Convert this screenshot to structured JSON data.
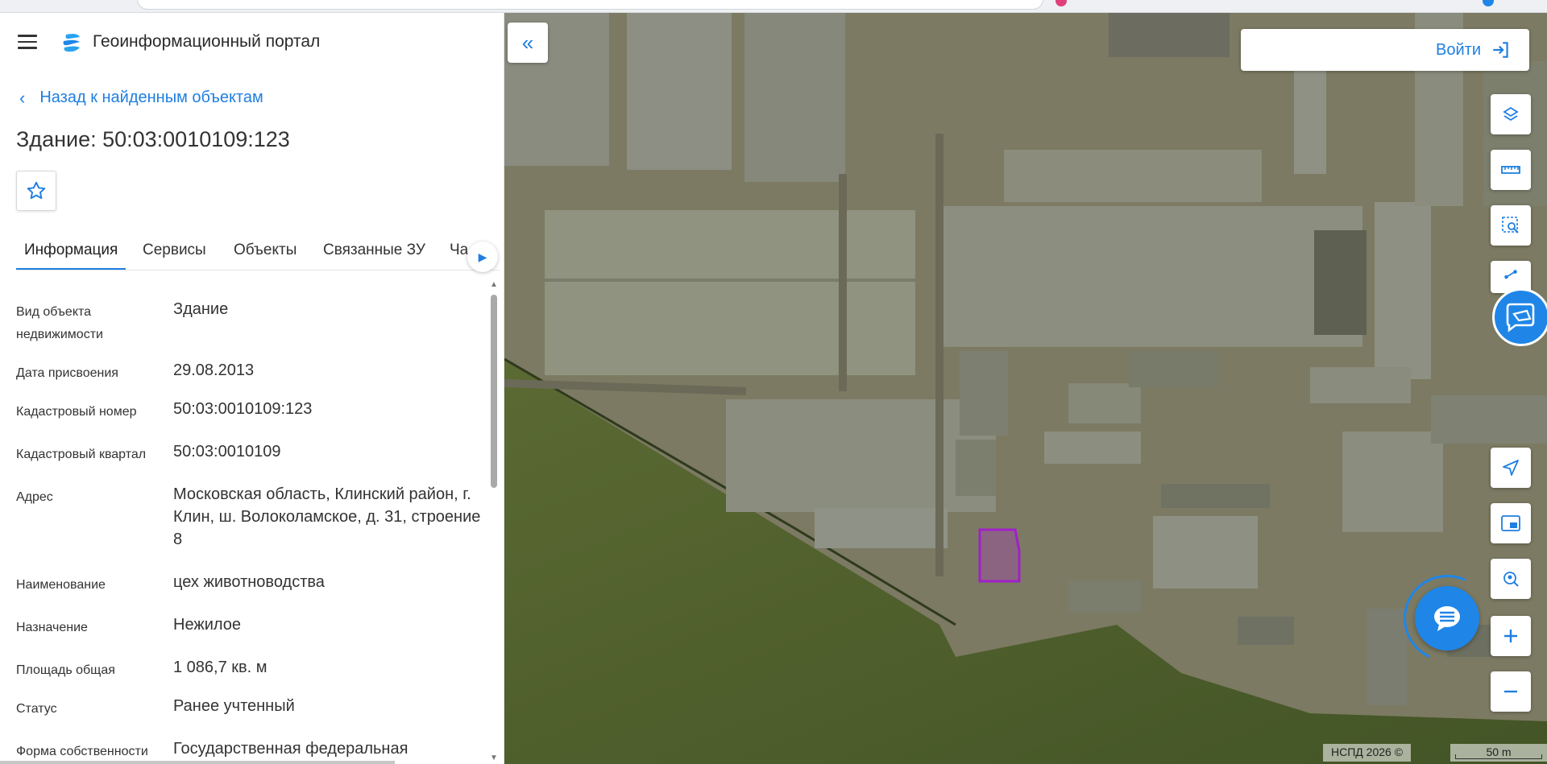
{
  "header": {
    "portal_title": "Геоинформационный портал"
  },
  "navigation": {
    "back_label": "Назад к найденным объектам"
  },
  "object": {
    "title": "Здание: 50:03:0010109:123"
  },
  "tabs": [
    {
      "label": "Информация",
      "active": true
    },
    {
      "label": "Сервисы",
      "active": false
    },
    {
      "label": "Объекты",
      "active": false
    },
    {
      "label": "Связанные ЗУ",
      "active": false
    },
    {
      "label": "Ча",
      "active": false
    }
  ],
  "info_rows": [
    {
      "label": "Вид объекта недвижимости",
      "value": "Здание"
    },
    {
      "label": "Дата присвоения",
      "value": "29.08.2013"
    },
    {
      "label": "Кадастровый номер",
      "value": "50:03:0010109:123"
    },
    {
      "label": "Кадастровый квартал",
      "value": "50:03:0010109"
    },
    {
      "label": "Адрес",
      "value": "Московская область, Клинский район, г. Клин, ш. Волоколамское, д. 31, строение 8"
    },
    {
      "label": "Наименование",
      "value": "цех животноводства"
    },
    {
      "label": "Назначение",
      "value": "Нежилое"
    },
    {
      "label": "Площадь общая",
      "value": "1 086,7 кв. м"
    },
    {
      "label": "Статус",
      "value": "Ранее учтенный"
    },
    {
      "label": "Форма собственности",
      "value": "Государственная федеральная"
    }
  ],
  "map": {
    "login_label": "Войти",
    "attribution": "НСПД 2026 ©",
    "scale_label": "50 m",
    "selection_color": "#a020c8",
    "accent_color": "#1f86e8",
    "tools": [
      "layers-icon",
      "ruler-icon",
      "area-search-icon",
      "share-icon",
      "locate-icon",
      "minimap-icon",
      "geo-search-icon",
      "zoom-in-icon",
      "zoom-out-icon"
    ]
  }
}
